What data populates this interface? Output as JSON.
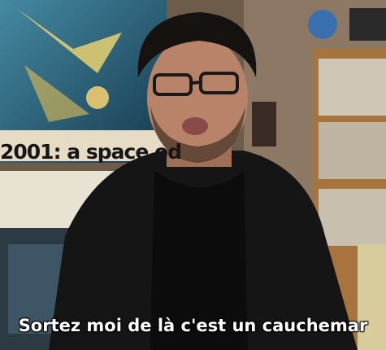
{
  "poster": {
    "title": "2001: a space od"
  },
  "caption": {
    "text": "Sortez moi de là c'est un cauchemar"
  },
  "colors": {
    "hoodie": "#151515",
    "skin": "#b9836a",
    "wall": "#7a6754",
    "shelf": "#b07a45"
  }
}
